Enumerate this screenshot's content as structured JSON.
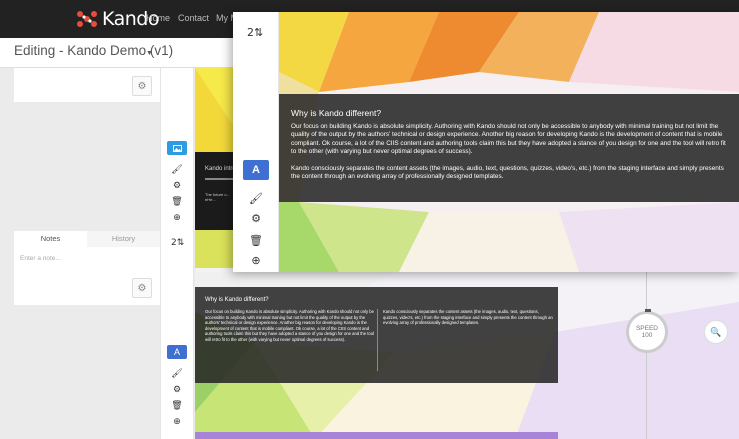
{
  "nav": {
    "brand": "Kando",
    "links": [
      "Home",
      "Contact",
      "My M"
    ]
  },
  "editbar": {
    "title": "Editing - Kando Demo (v1)"
  },
  "sidebar": {
    "tabs": [
      {
        "label": "Notes",
        "active": true
      },
      {
        "label": "History",
        "active": false
      }
    ],
    "note_placeholder": "Enter a note..."
  },
  "rows": {
    "row1_counter": "2",
    "row2_counter": "2",
    "overlay_counter": "2"
  },
  "toolbar": {
    "text_button_label": "A"
  },
  "small_slide": {
    "heading": "Kando intro",
    "text": "The future o... eHe..."
  },
  "main_slide": {
    "heading": "Why is Kando different?",
    "paragraph1": "Our focus on building Kando is absolute simplicity. Authoring with Kando should not only be accessible to anybody with minimal training but not limit the quality of the output by the authors' technical or design experience. Another big reason for developing Kando is the development of content that is mobile compliant. Ok course, a lot of the CIIS content and authoring tools claim this but they have adopted a stance of you design for one and the tool will retro fit to the other (with varying but never optimal degrees of success).",
    "paragraph2": "Kando consciously separates the content assets (the images, audio, text, questions, quizzes, video's, etc.) from the staging interface and simply presents the content through an evolving array of professionally designed templates."
  },
  "lower_slide": {
    "heading": "Why is Kando different?",
    "col1": "Our focus on building Kando is absolute simplicity. Authoring with Kando should not only be accessible to anybody with minimal training but not limit the quality of the output by the authors' technical or design experience. Another big reason for developing Kando is the development of content that is mobile compliant. Ok course, a lot of the CIIS content and authoring tools claim this but they have adopted a stance of you design for one and the tool will retro fit to the other (with varying but never optimal degrees of success).",
    "col2": "Kando consciously separates the content assets (the images, audio, text, questions, quizzes, video's, etc.) from the staging interface and simply presents the content through an evolving array of professionally designed templates."
  },
  "speed": {
    "label": "SPEED",
    "value": "100"
  },
  "colors": {
    "accent": "#3f6fd1",
    "nav": "#222222",
    "panel": "#282828"
  },
  "icons": [
    "kando-logo-icon",
    "gear-icon",
    "image-icon",
    "brush-icon",
    "trash-icon",
    "plus-circle-icon",
    "sort-icon",
    "zoom-icon"
  ]
}
